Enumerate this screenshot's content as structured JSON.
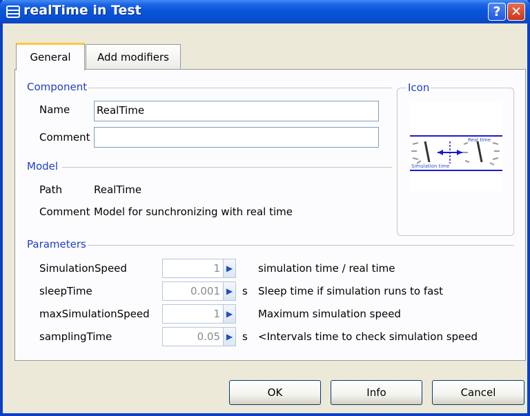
{
  "window": {
    "title": "realTime in Test",
    "title_icon": "component-icon",
    "help_glyph": "?",
    "close_glyph": "✕"
  },
  "tabs": [
    {
      "label": "General",
      "active": true
    },
    {
      "label": "Add modifiers",
      "active": false
    }
  ],
  "component": {
    "section_title": "Component",
    "name_label": "Name",
    "name_value": "RealTime",
    "comment_label": "Comment",
    "comment_value": ""
  },
  "icon_section": {
    "title": "Icon",
    "label_top": "Real time",
    "label_bottom": "Simulation time"
  },
  "model": {
    "section_title": "Model",
    "path_label": "Path",
    "path_value": "RealTime",
    "comment_label": "Comment",
    "comment_value": "Model for sunchronizing with real time"
  },
  "parameters": {
    "section_title": "Parameters",
    "rows": [
      {
        "name": "SimulationSpeed",
        "value": "1",
        "unit": "",
        "description": "simulation time / real time"
      },
      {
        "name": "sleepTime",
        "value": "0.001",
        "unit": "s",
        "description": "Sleep time if simulation runs to fast"
      },
      {
        "name": "maxSimulationSpeed",
        "value": "1",
        "unit": "",
        "description": "Maximum simulation speed"
      },
      {
        "name": "samplingTime",
        "value": "0.05",
        "unit": "s",
        "description": "<Intervals time to check simulation speed"
      }
    ],
    "spin_glyph": "▶"
  },
  "buttons": {
    "ok": "OK",
    "info": "Info",
    "cancel": "Cancel"
  },
  "colors": {
    "titlebar": "#0A4FCF",
    "section_title": "#1F3EC8",
    "active_tab_accent": "#FFC83C"
  }
}
